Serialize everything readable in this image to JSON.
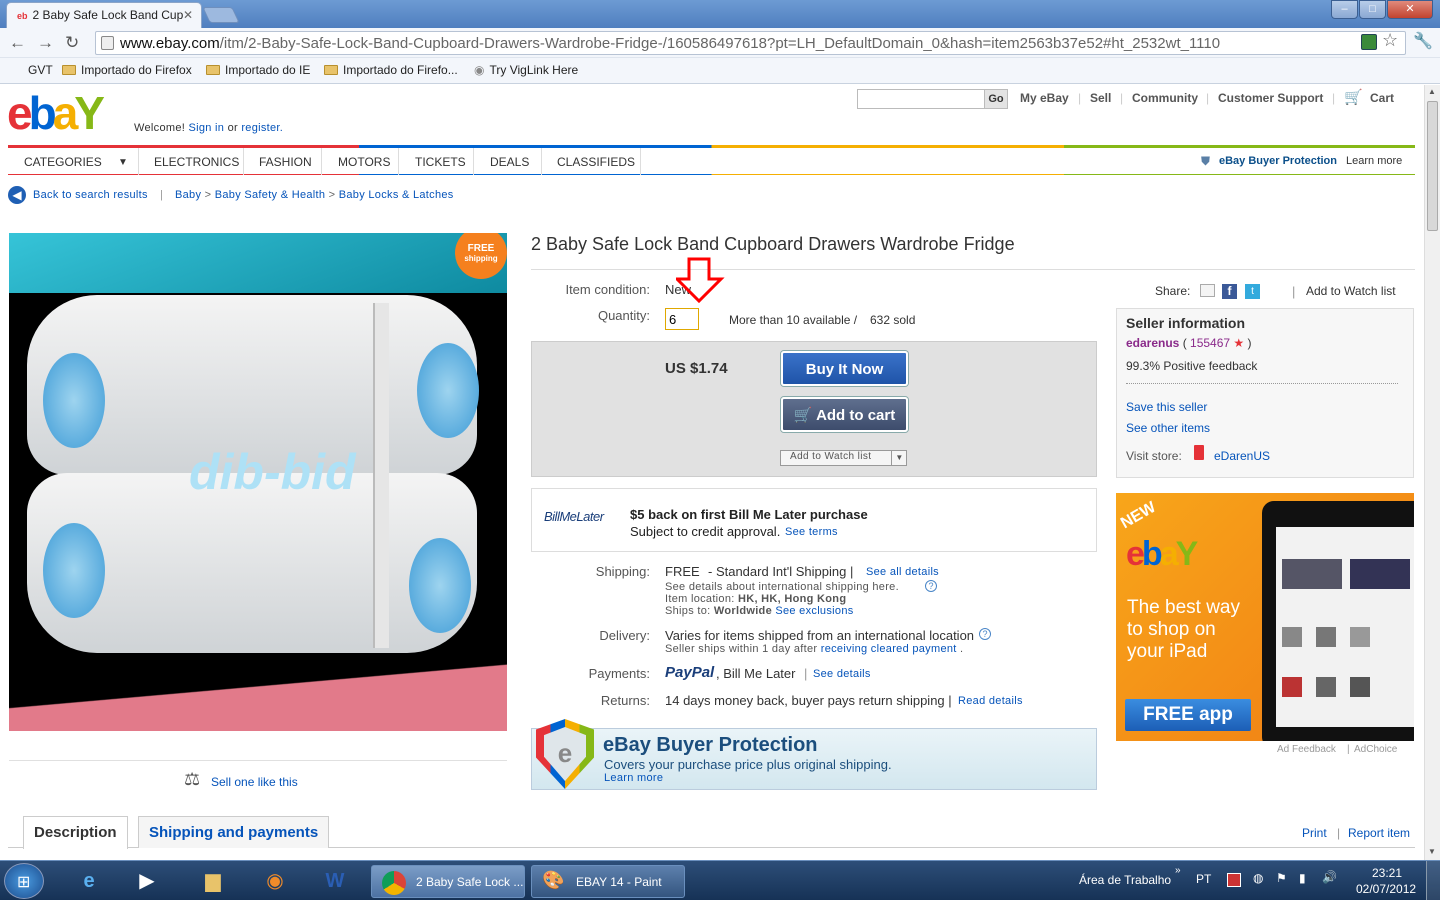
{
  "browser": {
    "tab_title": "2 Baby Safe Lock Band Cup",
    "url_host": "www.ebay.com",
    "url_rest": "/itm/2-Baby-Safe-Lock-Band-Cupboard-Drawers-Wardrobe-Fridge-/160586497618?pt=LH_DefaultDomain_0&hash=item2563b37e52#ht_2532wt_1110",
    "bookmarks": [
      "GVT",
      "Importado do Firefox",
      "Importado do IE",
      "Importado do Firefo...",
      "Try VigLink Here"
    ]
  },
  "header": {
    "welcome": "Welcome!",
    "sign_in": "Sign in",
    "or": "or",
    "register": "register.",
    "go": "Go",
    "links": [
      "My eBay",
      "Sell",
      "Community",
      "Customer Support"
    ],
    "cart": "Cart",
    "categories": [
      "CATEGORIES",
      "ELECTRONICS",
      "FASHION",
      "MOTORS",
      "TICKETS",
      "DEALS",
      "CLASSIFIEDS"
    ],
    "buyer_protection": "eBay Buyer Protection",
    "learn_more": "Learn more"
  },
  "breadcrumb": {
    "back": "Back to search results",
    "path": [
      "Baby",
      "Baby Safety & Health",
      "Baby Locks & Latches"
    ]
  },
  "item": {
    "title": "2 Baby Safe Lock Band Cupboard Drawers Wardrobe Fridge",
    "free_shipping_badge": [
      "FREE",
      "shipping"
    ],
    "watermark": "dib-bid",
    "condition_label": "Item condition:",
    "condition_value": "New",
    "quantity_label": "Quantity:",
    "quantity_value": "6",
    "availability": "More than 10 available /",
    "sold": "632 sold",
    "price": "US $1.74",
    "buy_now": "Buy It Now",
    "add_to_cart": "Add to cart",
    "add_to_watch": "Add to Watch list",
    "sell_one": "Sell one like this"
  },
  "bml": {
    "logo": "BillMeLater",
    "headline": "$5 back on first Bill Me Later purchase",
    "sub": "Subject to credit approval.",
    "see_terms": "See terms"
  },
  "shipping": {
    "label": "Shipping:",
    "cost": "FREE",
    "service": "- Standard Int'l Shipping |",
    "see_all": "See all details",
    "intl": "See details about international shipping here.",
    "location_label": "Item location:",
    "location": "HK, HK, Hong Kong",
    "ships_to_label": "Ships to:",
    "ships_to": "Worldwide",
    "exclusions": "See exclusions"
  },
  "delivery": {
    "label": "Delivery:",
    "text": "Varies for items shipped from an international location",
    "sub": "Seller ships within 1 day after",
    "link": "receiving cleared payment"
  },
  "payments": {
    "label": "Payments:",
    "paypal": "PayPal",
    "text": ", Bill Me Later",
    "see": "See details"
  },
  "returns": {
    "label": "Returns:",
    "text": "14 days money back, buyer pays return shipping |",
    "link": "Read details"
  },
  "protection": {
    "title": "eBay Buyer Protection",
    "sub": "Covers your purchase price plus original shipping.",
    "learn": "Learn more"
  },
  "share": {
    "label": "Share:",
    "watch": "Add to Watch list"
  },
  "seller": {
    "heading": "Seller information",
    "name": "edarenus",
    "score": "155467",
    "feedback": "99.3% Positive feedback",
    "save": "Save this seller",
    "other": "See other items",
    "visit_label": "Visit store:",
    "store": "eDarenUS"
  },
  "ad": {
    "new": "NEW",
    "text": "The best way to shop on your iPad",
    "cta": "FREE app",
    "feedback": "Ad Feedback",
    "choice": "AdChoice"
  },
  "tabs": [
    "Description",
    "Shipping and payments"
  ],
  "footer_links": [
    "Print",
    "Report item"
  ],
  "taskbar": {
    "apps": [
      "2 Baby Safe Lock ...",
      "EBAY 14 - Paint"
    ],
    "desktop": "Área de Trabalho",
    "lang": "PT",
    "time": "23:21",
    "date": "02/07/2012"
  },
  "colors": {
    "ebay_red": "#e53238",
    "ebay_blue": "#0064d2",
    "ebay_yellow": "#f5af02",
    "ebay_green": "#86b817",
    "button_blue": "#2b5fb4",
    "annotation_red": "#ff0000"
  }
}
